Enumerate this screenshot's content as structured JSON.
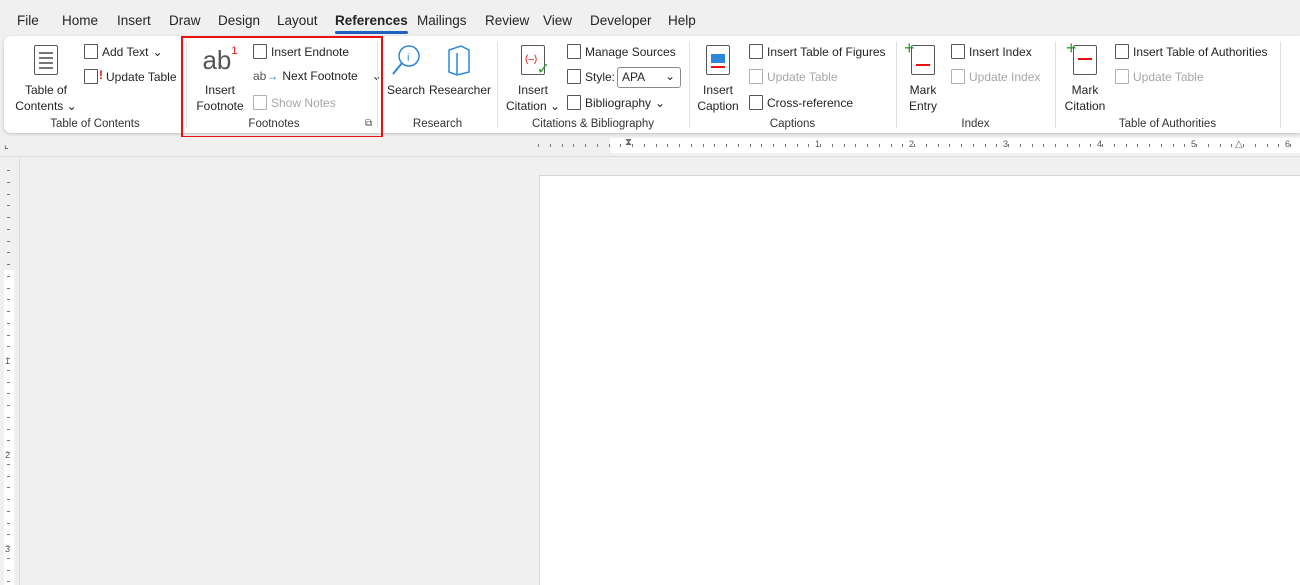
{
  "tabs": [
    {
      "label": "File"
    },
    {
      "label": "Home"
    },
    {
      "label": "Insert"
    },
    {
      "label": "Draw"
    },
    {
      "label": "Design"
    },
    {
      "label": "Layout"
    },
    {
      "label": "References",
      "active": true
    },
    {
      "label": "Mailings"
    },
    {
      "label": "Review"
    },
    {
      "label": "View"
    },
    {
      "label": "Developer"
    },
    {
      "label": "Help"
    }
  ],
  "groups": {
    "toc": {
      "label": "Table of Contents",
      "toc_line1": "Table of",
      "toc_line2": "Contents",
      "add_text": "Add Text",
      "update_table": "Update Table"
    },
    "footnotes": {
      "label": "Footnotes",
      "insert_line1": "Insert",
      "insert_line2": "Footnote",
      "insert_endnote": "Insert Endnote",
      "next_footnote": "Next Footnote",
      "show_notes": "Show Notes",
      "highlighted": true
    },
    "research": {
      "label": "Research",
      "search": "Search",
      "researcher": "Researcher"
    },
    "citations": {
      "label": "Citations & Bibliography",
      "insert_line1": "Insert",
      "insert_line2": "Citation",
      "manage_sources": "Manage Sources",
      "style_label": "Style:",
      "style_value": "APA",
      "bibliography": "Bibliography"
    },
    "captions": {
      "label": "Captions",
      "insert_line1": "Insert",
      "insert_line2": "Caption",
      "insert_tof": "Insert Table of Figures",
      "update_table": "Update Table",
      "cross_reference": "Cross-reference"
    },
    "index": {
      "label": "Index",
      "mark_line1": "Mark",
      "mark_line2": "Entry",
      "insert_index": "Insert Index",
      "update_index": "Update Index"
    },
    "toa": {
      "label": "Table of Authorities",
      "mark_line1": "Mark",
      "mark_line2": "Citation",
      "insert_toa": "Insert Table of Authorities",
      "update_table": "Update Table"
    }
  },
  "ruler": {
    "numbers": [
      "1",
      "2",
      "3",
      "4",
      "5",
      "6"
    ]
  },
  "vruler": {
    "numbers": [
      "1",
      "2",
      "3"
    ]
  },
  "colors": {
    "accent": "#1f5fbf",
    "highlight": "#e81010"
  }
}
